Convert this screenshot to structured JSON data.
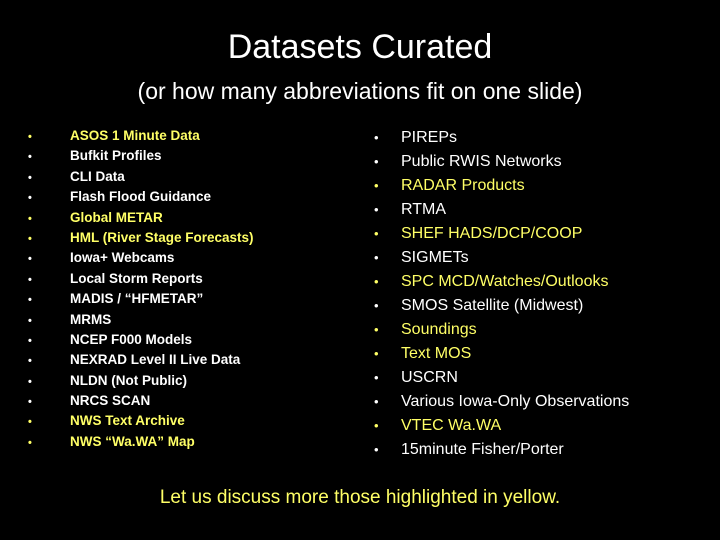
{
  "slide": {
    "title": "Datasets Curated",
    "subtitle": "(or how many abbreviations fit on one slide)",
    "highlight_color": "#ffff66",
    "text_color": "#ffffff",
    "background_color": "#000000",
    "bullet_glyph": "•",
    "left_items": [
      {
        "label": "ASOS 1 Minute Data",
        "highlighted": true
      },
      {
        "label": "Bufkit Profiles",
        "highlighted": false
      },
      {
        "label": "CLI Data",
        "highlighted": false
      },
      {
        "label": "Flash Flood Guidance",
        "highlighted": false
      },
      {
        "label": "Global METAR",
        "highlighted": true
      },
      {
        "label": "HML (River Stage Forecasts)",
        "highlighted": true
      },
      {
        "label": "Iowa+ Webcams",
        "highlighted": false
      },
      {
        "label": "Local Storm Reports",
        "highlighted": false
      },
      {
        "label": "MADIS / “HFMETAR”",
        "highlighted": false
      },
      {
        "label": "MRMS",
        "highlighted": false
      },
      {
        "label": "NCEP F000 Models",
        "highlighted": false
      },
      {
        "label": "NEXRAD Level II Live Data",
        "highlighted": false
      },
      {
        "label": "NLDN (Not Public)",
        "highlighted": false
      },
      {
        "label": "NRCS SCAN",
        "highlighted": false
      },
      {
        "label": "NWS Text Archive",
        "highlighted": true
      },
      {
        "label": "NWS “Wa.WA” Map",
        "highlighted": true
      }
    ],
    "right_items": [
      {
        "label": "PIREPs",
        "highlighted": false
      },
      {
        "label": "Public RWIS Networks",
        "highlighted": false
      },
      {
        "label": "RADAR Products",
        "highlighted": true
      },
      {
        "label": "RTMA",
        "highlighted": false
      },
      {
        "label": "SHEF HADS/DCP/COOP",
        "highlighted": true
      },
      {
        "label": "SIGMETs",
        "highlighted": false
      },
      {
        "label": "SPC MCD/Watches/Outlooks",
        "highlighted": true
      },
      {
        "label": "SMOS Satellite (Midwest)",
        "highlighted": false
      },
      {
        "label": "Soundings",
        "highlighted": true
      },
      {
        "label": "Text MOS",
        "highlighted": true
      },
      {
        "label": "USCRN",
        "highlighted": false
      },
      {
        "label": "Various Iowa-Only Observations",
        "highlighted": false
      },
      {
        "label": "VTEC Wa.WA",
        "highlighted": true
      },
      {
        "label": "15minute Fisher/Porter",
        "highlighted": false
      }
    ],
    "footer": "Let us discuss more those highlighted in yellow."
  }
}
